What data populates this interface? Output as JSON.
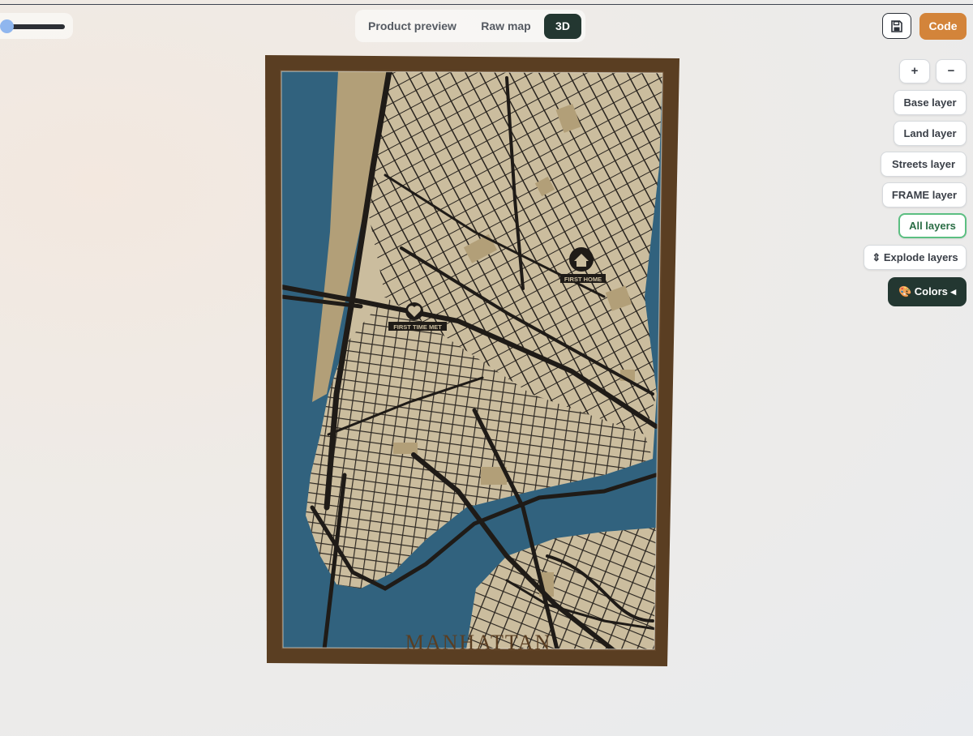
{
  "slider": {
    "value_fraction": 0.0
  },
  "tabs": [
    {
      "label": "Product preview"
    },
    {
      "label": "Raw map"
    },
    {
      "label": "3D"
    }
  ],
  "active_tab": "3D",
  "toolbar": {
    "save_icon": "floppy-disk-icon",
    "code_label": "Code"
  },
  "zoom": {
    "in_label": "+",
    "out_label": "−"
  },
  "layers": [
    {
      "label": "Base layer"
    },
    {
      "label": "Land layer"
    },
    {
      "label": "Streets layer"
    },
    {
      "label": "FRAME layer"
    },
    {
      "label": "All layers"
    },
    {
      "label": "⇕ Explode layers"
    }
  ],
  "colors_button": {
    "label": "🎨 Colors ◂"
  },
  "map": {
    "title": "MANHATTAN",
    "markers": [
      {
        "label": "FIRST HOME",
        "icon": "house-icon"
      },
      {
        "label": "FIRST TIME MET",
        "icon": "heart-icon"
      }
    ],
    "colors": {
      "frame": "#5a3e22",
      "water": "#31627e",
      "land": "#cbbd9e",
      "park": "#b29f78",
      "streets": "#1f1b17",
      "accent": "#d3843a",
      "active_tab": "#233731"
    }
  }
}
